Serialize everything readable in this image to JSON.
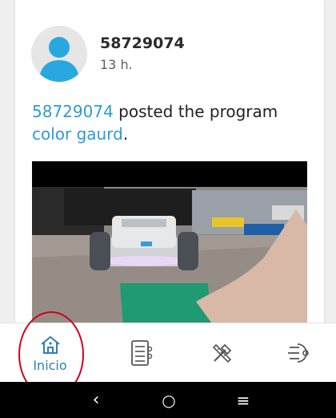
{
  "post": {
    "username": "58729074",
    "time": "13 h.",
    "author_link": "58729074",
    "action_text": " posted the program",
    "program_link": "color gaurd",
    "end_punct": "."
  },
  "nav": {
    "items": [
      {
        "label": "Inicio",
        "icon": "home-icon",
        "active": true
      },
      {
        "label": "",
        "icon": "program-list-icon"
      },
      {
        "label": "",
        "icon": "build-tools-icon"
      },
      {
        "label": "",
        "icon": "menu-more-icon"
      }
    ]
  },
  "system_nav": {
    "back": "‹",
    "home": "○",
    "recents": "≡"
  },
  "colors": {
    "accent": "#2f9ad6",
    "nav_active": "#2f7fb7",
    "annotation": "#d0021b"
  }
}
